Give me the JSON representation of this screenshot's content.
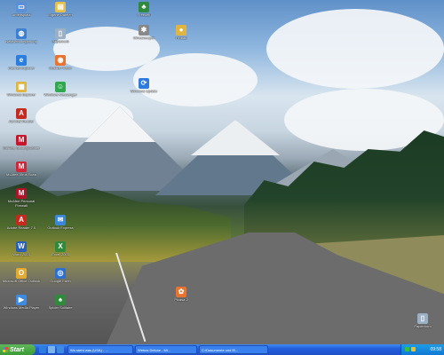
{
  "desktop": {
    "icons": [
      {
        "label": "Arbeitsplatz",
        "color": "#5b8fd6",
        "glyph": "▭"
      },
      {
        "label": "Eigene Dateien",
        "color": "#e3c04e",
        "glyph": "▤"
      },
      {
        "label": "Netzwerkumgebung",
        "color": "#3f7fd0",
        "glyph": "◍"
      },
      {
        "label": "Papierkorb",
        "color": "#9ab0c4",
        "glyph": "▯"
      },
      {
        "label": "Internet Explorer",
        "color": "#2b7de0",
        "glyph": "e"
      },
      {
        "label": "Mozilla Firefox",
        "color": "#e8722e",
        "glyph": "◉"
      },
      {
        "label": "Windows Explorer",
        "color": "#e0b440",
        "glyph": "▦"
      },
      {
        "label": "Windows Messenger",
        "color": "#2fa84f",
        "glyph": "☺"
      },
      {
        "label": "Acrobat Reader",
        "color": "#c52a1e",
        "glyph": "A"
      },
      {
        "label": "McAfee SecurityCenter",
        "color": "#c7152b",
        "glyph": "M"
      },
      {
        "label": "McAfee Virus Scan",
        "color": "#d0283a",
        "glyph": "M"
      },
      {
        "label": "McAfee Personal Firewall",
        "color": "#b01428",
        "glyph": "M"
      },
      {
        "label": "Adobe Reader 7.0",
        "color": "#c52a1e",
        "glyph": "A"
      },
      {
        "label": "Outlook Express",
        "color": "#3a86d8",
        "glyph": "✉"
      },
      {
        "label": "Word 2003",
        "color": "#2a5fb8",
        "glyph": "W"
      },
      {
        "label": "Excel 2003",
        "color": "#2f8a3c",
        "glyph": "X"
      },
      {
        "label": "Microsoft Office Outlook",
        "color": "#e3a933",
        "glyph": "O"
      },
      {
        "label": "Google Earth",
        "color": "#2b6fcf",
        "glyph": "◎"
      },
      {
        "label": "Windows Media Player",
        "color": "#3c8be0",
        "glyph": "▶"
      },
      {
        "label": "Spider Solitaire",
        "color": "#2f8a3c",
        "glyph": "♠"
      },
      {
        "label": "Freecell",
        "color": "#2f8a3c",
        "glyph": "♣"
      },
      {
        "label": "Minesweeper",
        "color": "#888888",
        "glyph": "✱"
      },
      {
        "label": "Pinball",
        "color": "#e0b440",
        "glyph": "●"
      },
      {
        "label": "Windows Update",
        "color": "#2c7be0",
        "glyph": "⟳"
      },
      {
        "label": "Picasa 2",
        "color": "#e8722e",
        "glyph": "✿"
      },
      {
        "label": "Papierkorb",
        "color": "#9ab0c4",
        "glyph": "▯"
      }
    ]
  },
  "taskbar": {
    "start_label": "Start",
    "tasks": [
      {
        "label": "Wo steht was (USA) - ..."
      },
      {
        "label": "Webos Deluxe - Mi..."
      },
      {
        "label": "C:\\Dokumente und Ei..."
      }
    ],
    "clock": "09:58"
  }
}
